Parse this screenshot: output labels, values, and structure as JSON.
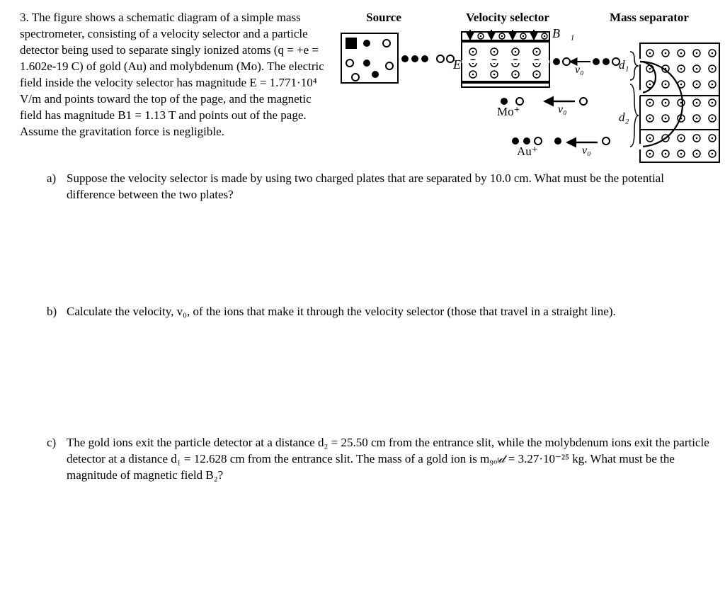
{
  "figure": {
    "label_source": "Source",
    "label_selector": "Velocity selector",
    "label_separator": "Mass separator",
    "E_vec": "E⃗",
    "B1_vec": "B⃗₁",
    "v0_a": "v₀",
    "v0_b": "v₀",
    "v0_c": "v₀",
    "d1": "d₁",
    "d2": "d₂",
    "mo_plus": "Mo⁺",
    "au_plus": "Au⁺"
  },
  "intro": "3. The figure shows a schematic diagram of a simple mass spectrometer, consisting of a velocity selector and a particle detector being used to separate singly ionized atoms (q = +e = 1.602e-19 C) of gold (Au) and molybdenum (Mo). The electric field inside the velocity selector has magnitude E = 1.771·10⁴ V/m and points toward the top of the page, and the magnetic field has magnitude B1 = 1.13 T and points out of the page. Assume the gravitation force is negligible.",
  "a_letter": "a)",
  "a_body": "Suppose the velocity selector is made by using two charged plates that are separated by 10.0 cm. What must be the potential difference between the two plates?",
  "b_letter": "b)",
  "b_body": "Calculate the velocity, v₀, of the ions that make it through the velocity selector (those that travel in a straight line).",
  "c_letter": "c)",
  "c_body": "The gold ions exit the particle detector at a distance d₂ = 25.50 cm from the entrance slit, while the molybdenum ions exit the particle detector at a distance d₁ = 12.628 cm from the entrance slit. The mass of a gold ion is m₉ₒₗ𝒹 = 3.27·10⁻²⁵ kg. What must be the magnitude of magnetic field B₂?"
}
